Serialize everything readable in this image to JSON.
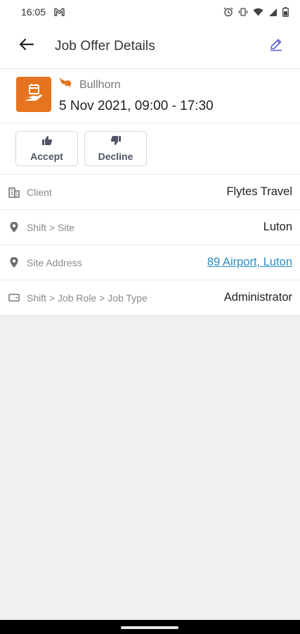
{
  "status_bar": {
    "time": "16:05",
    "left_icons": [
      "gmail-icon"
    ],
    "right_icons": [
      "alarm-icon",
      "vibrate-icon",
      "wifi-icon",
      "signal-icon",
      "battery-icon"
    ]
  },
  "app_bar": {
    "title": "Job Offer Details",
    "back_icon": "arrow-left-icon",
    "edit_icon": "pencil-icon"
  },
  "header": {
    "source": "Bullhorn",
    "datetime": "5 Nov 2021, 09:00 - 17:30",
    "tile_color": "#e5731f"
  },
  "actions": {
    "accept_label": "Accept",
    "decline_label": "Decline"
  },
  "details": [
    {
      "icon": "building-icon",
      "label": "Client",
      "value": "Flytes Travel"
    },
    {
      "icon": "location-pin-icon",
      "label": "Shift > Site",
      "value": "Luton"
    },
    {
      "icon": "location-pin-icon",
      "label": "Site Address",
      "value": "89 Airport, Luton",
      "is_link": true
    },
    {
      "icon": "id-card-icon",
      "label": "Shift > Job Role > Job Type",
      "value": "Administrator"
    }
  ],
  "colors": {
    "accent": "#5b5bd6",
    "link": "#2a8ec6",
    "brand_orange": "#e5731f"
  }
}
